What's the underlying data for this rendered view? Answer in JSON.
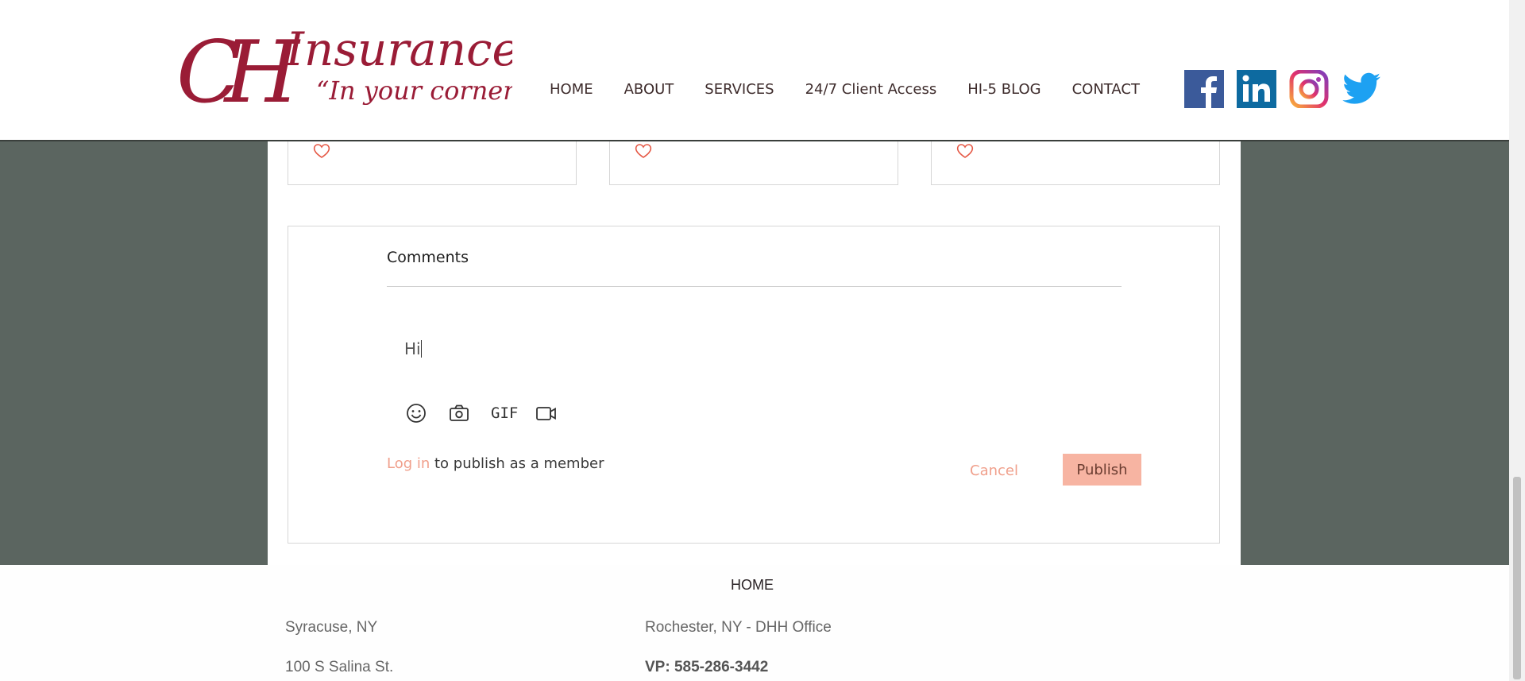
{
  "header": {
    "logo": {
      "brand": "CH",
      "name": "Insurance",
      "tagline": "“In your corner”"
    },
    "nav": [
      "HOME",
      "ABOUT",
      "SERVICES",
      "24/7 Client Access",
      "HI-5 BLOG",
      "CONTACT"
    ],
    "social": [
      "facebook-icon",
      "linkedin-icon",
      "instagram-icon",
      "twitter-icon"
    ]
  },
  "colors": {
    "brand": "#9a1c36",
    "accent": "#f0a08c",
    "publish_bg": "#f7b4a2",
    "page_bg": "#5b6560"
  },
  "cards": [
    {
      "icon": "heart-icon"
    },
    {
      "icon": "heart-icon"
    },
    {
      "icon": "heart-icon"
    }
  ],
  "comments": {
    "title": "Comments",
    "input_value": "Hi",
    "toolbar": {
      "emoji": "emoji-icon",
      "camera": "camera-icon",
      "gif_label": "GIF",
      "video": "video-icon"
    },
    "login_link": "Log in",
    "login_suffix": " to publish as a member",
    "cancel_label": "Cancel",
    "publish_label": "Publish"
  },
  "footer": {
    "home_link": "HOME",
    "col1": {
      "city": "Syracuse, NY",
      "address": "100 S Salina St."
    },
    "col2": {
      "city": "Rochester, NY - DHH Office",
      "phone": "VP: 585-286-3442"
    }
  }
}
